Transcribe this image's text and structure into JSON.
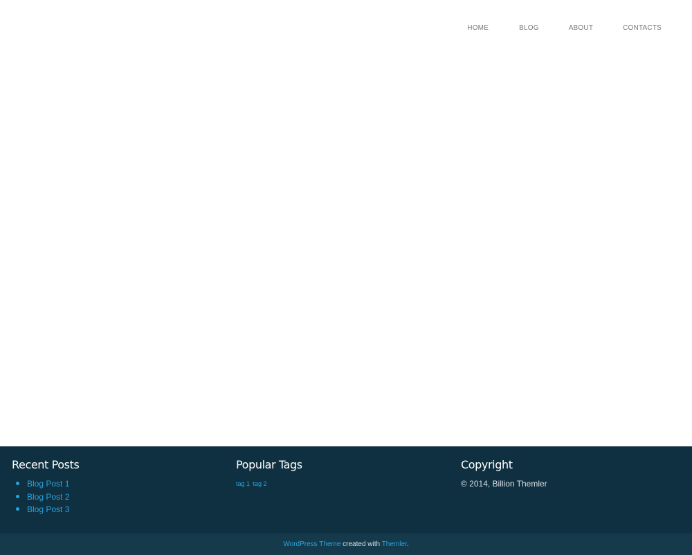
{
  "nav": {
    "items": [
      {
        "label": "HOME"
      },
      {
        "label": "BLOG"
      },
      {
        "label": "ABOUT"
      },
      {
        "label": "CONTACTS"
      }
    ]
  },
  "footer": {
    "recent_posts": {
      "title": "Recent Posts",
      "items": [
        {
          "label": "Blog Post 1"
        },
        {
          "label": "Blog Post 2"
        },
        {
          "label": "Blog Post 3"
        }
      ]
    },
    "popular_tags": {
      "title": "Popular Tags",
      "tags": [
        {
          "label": "tag 1"
        },
        {
          "label": "tag 2"
        }
      ]
    },
    "copyright": {
      "title": "Copyright",
      "text": "© 2014, Billion Themler"
    }
  },
  "bottom_bar": {
    "link1": "WordPress Theme",
    "middle": " created with ",
    "link2": "Themler",
    "end": "."
  },
  "colors": {
    "footer_bg": "#0f3040",
    "bottom_bg": "#153a4b",
    "link": "#2aa3dd",
    "nav_text": "#777777"
  }
}
